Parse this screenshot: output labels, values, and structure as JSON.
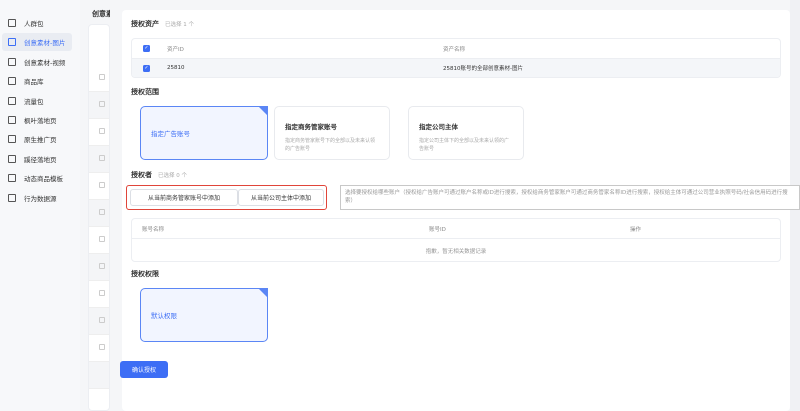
{
  "sidebar": {
    "items": [
      {
        "label": "人群包",
        "icon": "user-card-icon"
      },
      {
        "label": "创意素材-图片",
        "icon": "image-icon",
        "active": true
      },
      {
        "label": "创意素材-视频",
        "icon": "play-icon"
      },
      {
        "label": "商品库",
        "icon": "inbox-icon"
      },
      {
        "label": "流量包",
        "icon": "chart-icon"
      },
      {
        "label": "枫叶落地页",
        "icon": "list-icon"
      },
      {
        "label": "原生推广页",
        "icon": "page-icon"
      },
      {
        "label": "蹊径落地页",
        "icon": "doc-icon"
      },
      {
        "label": "动态商品模板",
        "icon": "layout-icon"
      },
      {
        "label": "行为数据源",
        "icon": "data-icon"
      }
    ]
  },
  "behind": {
    "title": "创意素材"
  },
  "assets": {
    "title": "授权资产",
    "count": "已选择 1 个",
    "columns": [
      "资产ID",
      "资产名称"
    ],
    "rows": [
      {
        "id": "25810",
        "name": "25810账号的全部创意素材-图片"
      }
    ]
  },
  "scope": {
    "title": "授权范围",
    "options": [
      {
        "title": "指定广告账号",
        "desc": "",
        "selected": true
      },
      {
        "title": "指定商务管家账号",
        "desc": "指定商务管家账号下的全部以及未来认领的广告账号"
      },
      {
        "title": "指定公司主体",
        "desc": "指定公司主体下的全部以及未来认领的广告账号"
      }
    ]
  },
  "grantee": {
    "title": "授权者",
    "count": "已选择 0 个",
    "btn_business": "从当前商务管家账号中添加",
    "btn_company": "从当前公司主体中添加",
    "search_placeholder": "选择要授权给哪些账户（授权给广告账户可通过账户名称或ID进行搜索，授权给商务管家账户可通过商务管家名称ID进行搜索，授权给主体可通过公司营业执照号码/社会信用码进行搜索）",
    "columns": [
      "账号名称",
      "账号ID",
      "操作"
    ],
    "empty": "抱歉，暂无相关数据记录"
  },
  "permission": {
    "title": "授权权限",
    "option": "默认权限"
  },
  "confirm_label": "确认授权",
  "colors": {
    "accent": "#3d6ef5",
    "highlight": "#e0453a"
  }
}
